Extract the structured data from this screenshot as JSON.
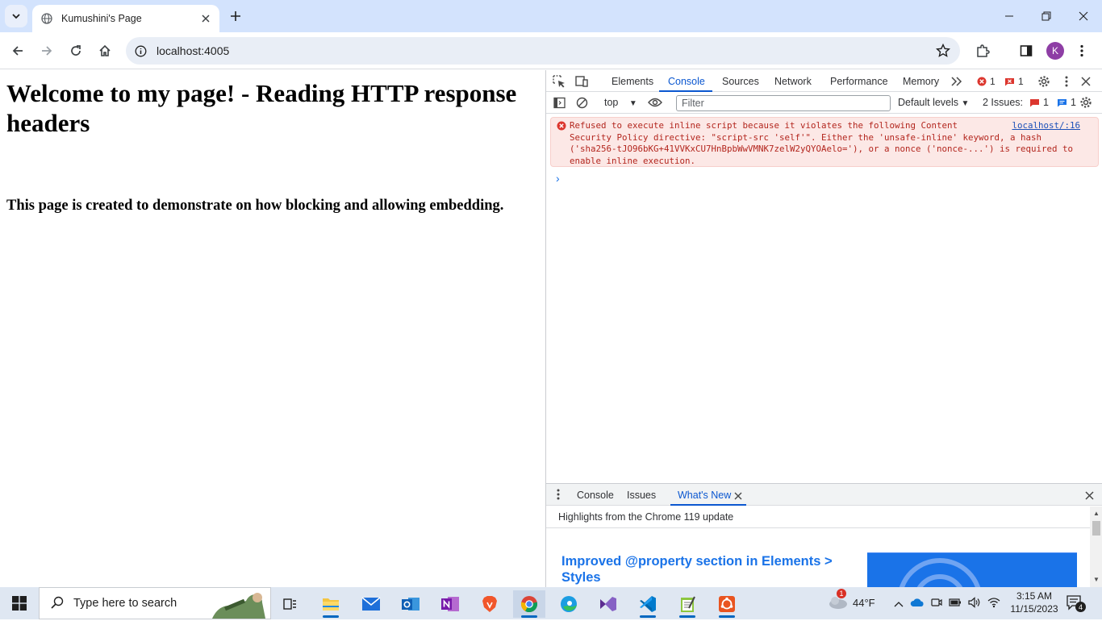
{
  "browser": {
    "tab_title": "Kumushini's Page",
    "url": "localhost:4005",
    "profile_initial": "K"
  },
  "page": {
    "heading": "Welcome to my page! - Reading HTTP response headers",
    "subheading": "This page is created to demonstrate on how blocking and allowing embedding."
  },
  "devtools": {
    "tabs": [
      "Elements",
      "Console",
      "Sources",
      "Network",
      "Performance",
      "Memory"
    ],
    "active_tab": "Console",
    "error_count": "1",
    "issue_count": "1",
    "context": "top",
    "filter_placeholder": "Filter",
    "levels": "Default levels",
    "issues_label": "2 Issues:",
    "issues_errors": "1",
    "issues_info": "1",
    "console_error": "Refused to execute inline script because it violates the following Content\nSecurity Policy directive: \"script-src 'self'\". Either the 'unsafe-inline' keyword, a hash\n('sha256-tJO96bKG+41VVKxCU7HnBpbWwVMNK7zelW2yQYOAelo='), or a nonce ('nonce-...') is required to\nenable inline execution.",
    "console_error_source": "localhost/:16",
    "drawer": {
      "tabs": [
        "Console",
        "Issues",
        "What's New"
      ],
      "active_tab": "What's New",
      "highlights": "Highlights from the Chrome 119 update",
      "whatsnew_heading": "Improved @property section in Elements > Styles"
    }
  },
  "taskbar": {
    "search_placeholder": "Type here to search",
    "weather_temp": "44°F",
    "weather_badge": "1",
    "time": "3:15 AM",
    "date": "11/15/2023",
    "notifications": "4"
  },
  "colors": {
    "accent": "#0b57d0",
    "error_bg": "#fce8e6",
    "error_text": "#b3261e",
    "tabstrip": "#d3e3fd"
  }
}
